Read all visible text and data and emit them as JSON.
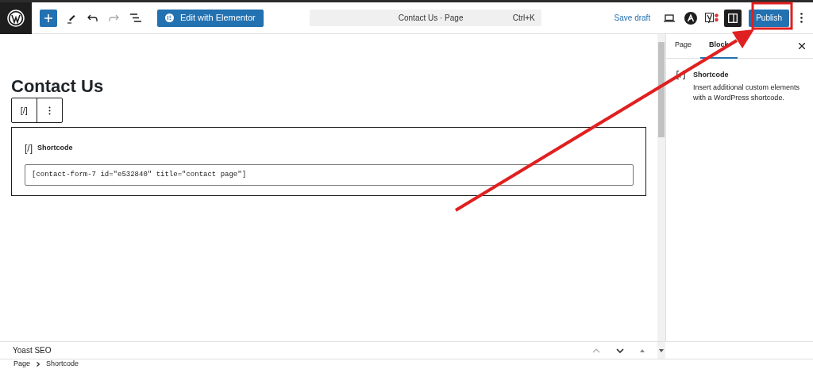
{
  "toolbar": {
    "elementor_button": "Edit with Elementor",
    "document_title": "Contact Us · Page",
    "shortcut": "Ctrl+K",
    "save_draft": "Save draft",
    "publish": "Publish"
  },
  "editor": {
    "page_title": "Contact Us",
    "block_toolbar_icon": "[/]",
    "block": {
      "icon": "[/]",
      "label": "Shortcode",
      "value": "[contact-form-7 id=\"e532840\" title=\"contact page\"]"
    }
  },
  "sidebar": {
    "tabs": [
      {
        "label": "Page",
        "selected": false
      },
      {
        "label": "Block",
        "selected": true
      }
    ],
    "block_card": {
      "title": "Shortcode",
      "description": "Insert additional custom elements with a WordPress shortcode."
    }
  },
  "yoast_panel": {
    "title": "Yoast SEO"
  },
  "breadcrumb": [
    "Page",
    "Shortcode"
  ]
}
